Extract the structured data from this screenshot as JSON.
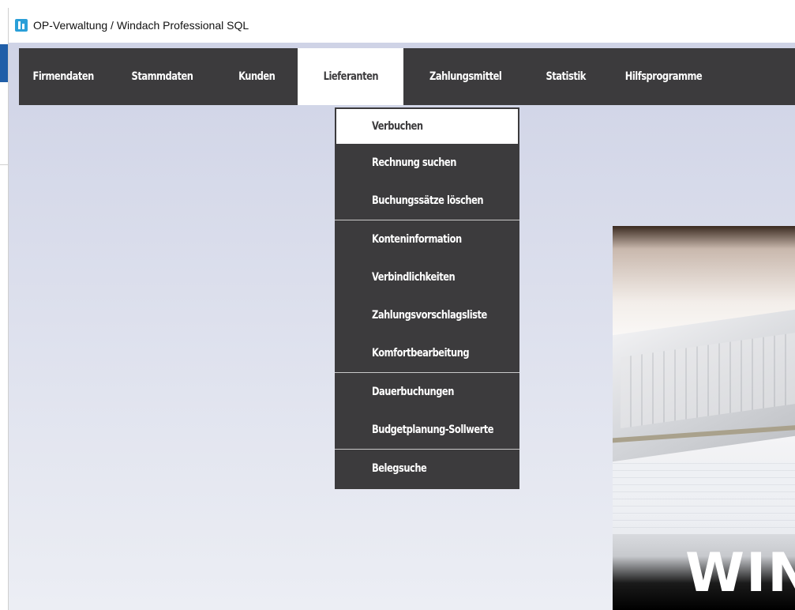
{
  "window": {
    "title": "OP-Verwaltung / Windach Professional SQL"
  },
  "menubar": {
    "items": [
      {
        "label": "Firmendaten"
      },
      {
        "label": "Stammdaten"
      },
      {
        "label": "Kunden"
      },
      {
        "label": "Lieferanten",
        "active": true
      },
      {
        "label": "Zahlungsmittel"
      },
      {
        "label": "Statistik"
      },
      {
        "label": "Hilfsprogramme"
      }
    ]
  },
  "dropdown": {
    "groups": [
      [
        {
          "label": "Verbuchen",
          "selected": true
        },
        {
          "label": "Rechnung suchen"
        },
        {
          "label": "Buchungssätze löschen"
        }
      ],
      [
        {
          "label": "Konteninformation"
        },
        {
          "label": "Verbindlichkeiten"
        },
        {
          "label": "Zahlungsvorschlagsliste"
        },
        {
          "label": "Komfortbearbeitung"
        }
      ],
      [
        {
          "label": "Dauerbuchungen"
        },
        {
          "label": "Budgetplanung-Sollwerte"
        }
      ],
      [
        {
          "label": "Belegsuche"
        }
      ]
    ]
  },
  "banner": {
    "text": "WIN"
  },
  "colors": {
    "menu_bg": "#3c3b3d",
    "menu_text": "#ffffff",
    "active_bg": "#ffffff",
    "client_bg_top": "#cfd3e6",
    "icon_blue": "#2a9fd8"
  }
}
